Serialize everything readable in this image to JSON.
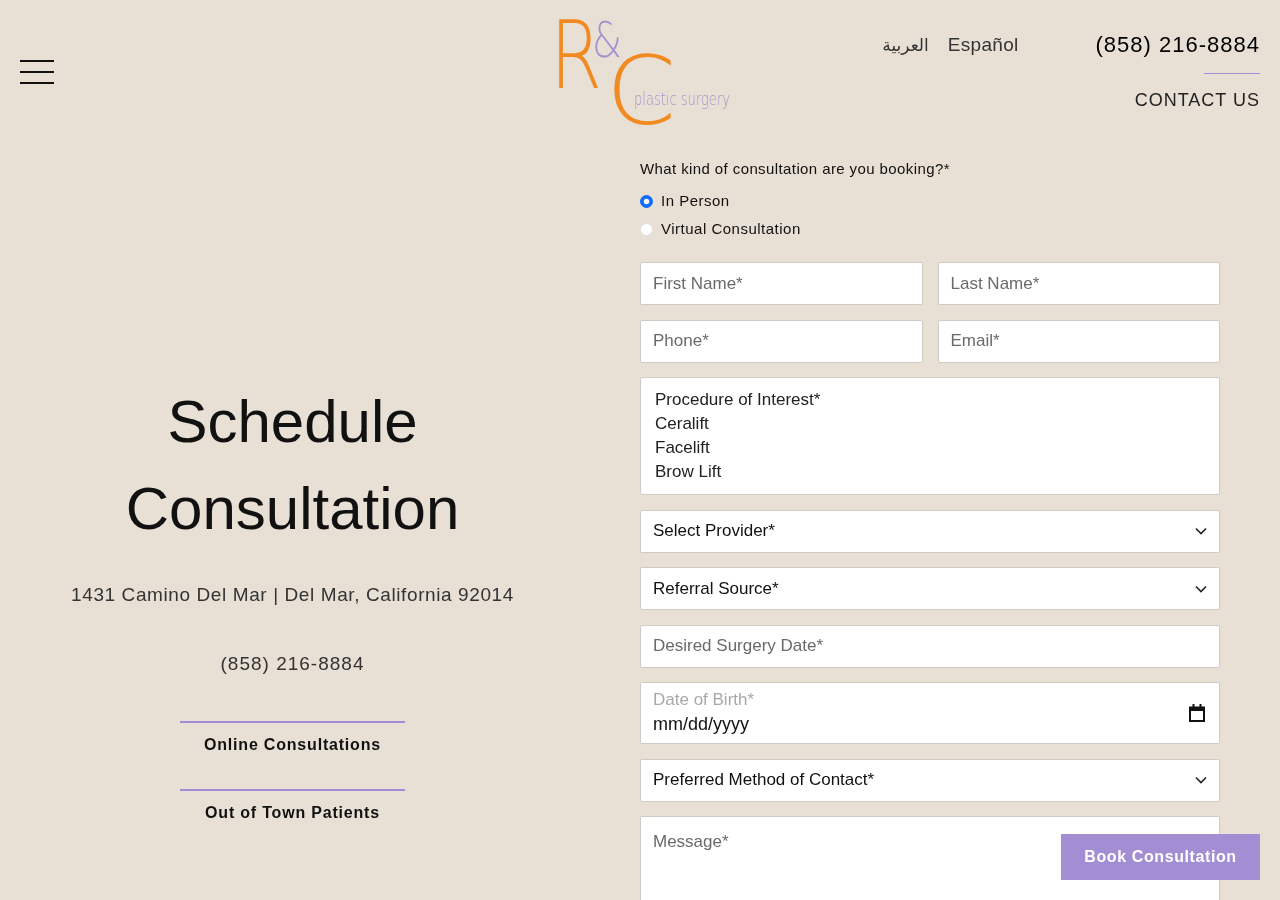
{
  "header": {
    "logo": {
      "letters": [
        "R",
        "&",
        "C"
      ],
      "tagline": "plastic surgery"
    },
    "languages": [
      "العربية",
      "Español"
    ],
    "phone": "(858) 216-8884",
    "contact_link": "CONTACT US"
  },
  "intro": {
    "title": "Schedule Consultation",
    "address": "1431 Camino Del Mar | Del Mar, California 92014",
    "phone": "(858) 216-8884",
    "links": [
      "Online Consultations",
      "Out of Town Patients"
    ]
  },
  "form": {
    "question": "What kind of consultation are you booking?*",
    "consultation_types": [
      {
        "label": "In Person",
        "selected": true
      },
      {
        "label": "Virtual Consultation",
        "selected": false
      }
    ],
    "rows": [
      [
        {
          "kind": "text",
          "placeholder": "First Name*"
        },
        {
          "kind": "text",
          "placeholder": "Last Name*"
        }
      ],
      [
        {
          "kind": "text",
          "placeholder": "Phone*"
        },
        {
          "kind": "text",
          "placeholder": "Email*"
        }
      ],
      [
        {
          "kind": "listbox",
          "options": [
            "Procedure of Interest*",
            "Ceralift",
            "Facelift",
            "Brow Lift"
          ]
        }
      ],
      [
        {
          "kind": "select",
          "value": "Select Provider*"
        }
      ],
      [
        {
          "kind": "select",
          "value": "Referral Source*"
        }
      ],
      [
        {
          "kind": "text",
          "placeholder": "Desired Surgery Date*"
        }
      ],
      [
        {
          "kind": "date",
          "label": "Date of Birth*",
          "value": "mm/dd/yyyy"
        }
      ],
      [
        {
          "kind": "select",
          "value": "Preferred Method of Contact*"
        }
      ],
      [
        {
          "kind": "textarea",
          "placeholder": "Message*"
        }
      ]
    ]
  },
  "book_button": "Book Consultation"
}
